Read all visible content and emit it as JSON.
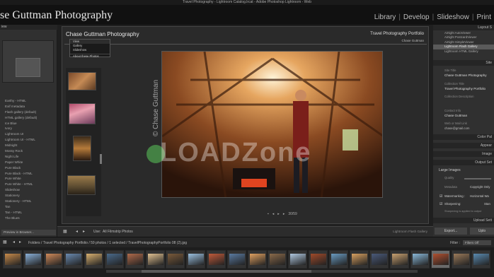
{
  "window": {
    "title": "Travel Photography - Lightroom Catalog.lrcat - Adobe Photoshop Lightroom - Web"
  },
  "identity": {
    "plate": "se Guttman Photography",
    "modules": [
      "Library",
      "Develop",
      "Slideshow",
      "Print"
    ]
  },
  "left": {
    "header": "iew",
    "templates": [
      "Earthy - HTML",
      "Exif metadata",
      "Flash gallery (default)",
      "HTML gallery (default)",
      "Ice Blue",
      "Ivory",
      "Lightroom UI",
      "Lightroom UI - HTML",
      "Midnight",
      "Mossy Rock",
      "Night Life",
      "Paper White",
      "Pure Black",
      "Pure Black - HTML",
      "Pure White",
      "Pure White - HTML",
      "Slideshow",
      "Stationery",
      "Stationery - HTML",
      "Tan",
      "Tan - HTML",
      "The Blues"
    ],
    "preview_button": "Preview in Browser..."
  },
  "gallery": {
    "site_title": "Chase Guttman Photography",
    "collection_title": "Travel Photography Portfolio",
    "photographer": "Chase Guttman",
    "menu": {
      "label": "View",
      "items": [
        "Gallery",
        "Slideshow",
        "About these Photos"
      ]
    },
    "pager": "30/59"
  },
  "watermark": {
    "text": "LOADZone",
    "vertical": "© Chase Guttman"
  },
  "toolbar": {
    "use_label": "Use:",
    "use_value": "All Filmstrip Photos",
    "gallery_type": "Lightroom Flash Gallery"
  },
  "right": {
    "layout_header": "Layout S",
    "layout_list": [
      "Airtight AutoViewer",
      "Airtight PostcardViewer",
      "Airtight SimpleViewer",
      "Lightroom Flash Gallery",
      "Lightroom HTML Gallery"
    ],
    "selected_layout": "Lightroom Flash Gallery",
    "site_header": "Site",
    "site_title_label": "Site Title",
    "site_title_value": "Chase Guttman Photography",
    "collection_title_label": "Collection Title",
    "collection_title_value": "Travel Photography Portfolio",
    "collection_desc_label": "Collection Description",
    "contact_label": "Contact Info",
    "contact_value": "Chase Guttman",
    "web_label": "Web or Mail Link",
    "web_value": "chase@gmail.com",
    "color_palette": "Color Pal",
    "appearance": "Appear",
    "image_info": "Image",
    "output_settings": "Output Set",
    "large_images": "Large Images",
    "quality_label": "Quality",
    "metadata_label": "Metadata",
    "metadata_value": "Copyright Only",
    "watermarking_label": "Watermarking :",
    "watermarking_value": "Horizontal Wa",
    "sharpening_label": "Sharpening:",
    "sharpening_value": "Stan",
    "sharpening_note": "Sharpening is applied to output",
    "upload_settings": "Upload Sett",
    "export_button": "Export...",
    "upload_button": "Uplo"
  },
  "filmbar": {
    "path": "Folders / Travel Photography Portfolio / 59 photos / 1 selected / TravelPhotographyPortfolio 08 (2).jpg",
    "filter_label": "Filter :",
    "filter_value": "Filters Off"
  },
  "colors": {
    "accent_select": "#5a5a5a",
    "panel_bg": "#303030",
    "photo_warm": "#c07a3c"
  }
}
